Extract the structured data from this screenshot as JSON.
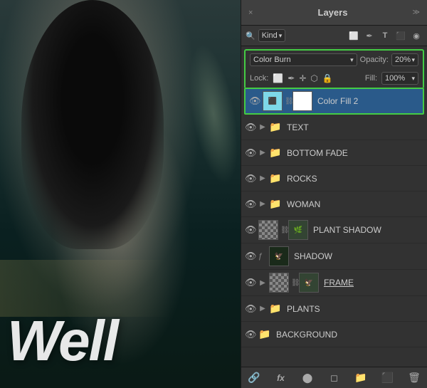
{
  "panel": {
    "title": "Layers",
    "close_label": "×",
    "collapse_label": "≫"
  },
  "filter_bar": {
    "filter_label": "Kind",
    "icons": [
      "pixel-icon",
      "brush-icon",
      "type-icon",
      "shape-icon",
      "adjustment-icon"
    ]
  },
  "blend_row": {
    "blend_mode": "Color Burn",
    "opacity_label": "Opacity:",
    "opacity_value": "20%",
    "chevron": "▾"
  },
  "lock_row": {
    "lock_label": "Lock:",
    "icons": [
      "lock-pixels-icon",
      "lock-position-icon",
      "lock-artboard-icon",
      "lock-all-icon"
    ],
    "fill_label": "Fill:",
    "fill_value": "100%",
    "fill_chevron": "▾"
  },
  "layers": [
    {
      "id": "color-fill-2",
      "name": "Color Fill 2",
      "visible": true,
      "selected": true,
      "has_arrow": false,
      "has_folder": false,
      "thumb1_type": "cyan",
      "thumb2_type": "white",
      "has_chain": true
    },
    {
      "id": "text",
      "name": "TEXT",
      "visible": true,
      "selected": false,
      "has_arrow": true,
      "has_folder": true,
      "thumb1_type": "folder",
      "thumb2_type": null,
      "has_chain": false
    },
    {
      "id": "bottom-fade",
      "name": "BOTTOM FADE",
      "visible": true,
      "selected": false,
      "has_arrow": true,
      "has_folder": true,
      "thumb1_type": "folder",
      "thumb2_type": null,
      "has_chain": false
    },
    {
      "id": "rocks",
      "name": "ROCKS",
      "visible": true,
      "selected": false,
      "has_arrow": true,
      "has_folder": true,
      "thumb1_type": "folder",
      "thumb2_type": null,
      "has_chain": false
    },
    {
      "id": "woman",
      "name": "WOMAN",
      "visible": true,
      "selected": false,
      "has_arrow": true,
      "has_folder": true,
      "thumb1_type": "folder",
      "thumb2_type": null,
      "has_chain": false
    },
    {
      "id": "plant-shadow",
      "name": "PLANT SHADOW",
      "visible": true,
      "selected": false,
      "has_arrow": false,
      "has_folder": false,
      "thumb1_type": "checker",
      "thumb2_type": "plant",
      "has_chain": true
    },
    {
      "id": "shadow",
      "name": "SHADOW",
      "visible": true,
      "selected": false,
      "has_arrow": false,
      "has_folder": false,
      "thumb1_type": "shadow",
      "thumb2_type": null,
      "has_chain": false,
      "has_special": true
    },
    {
      "id": "frame",
      "name": "FRAME",
      "visible": true,
      "selected": false,
      "has_arrow": true,
      "has_folder": false,
      "thumb1_type": "checker",
      "thumb2_type": "plant",
      "has_chain": true,
      "name_underline": true
    },
    {
      "id": "plants",
      "name": "PLANTS",
      "visible": true,
      "selected": false,
      "has_arrow": true,
      "has_folder": true,
      "thumb1_type": "folder",
      "thumb2_type": null,
      "has_chain": false
    },
    {
      "id": "background",
      "name": "BACKGROUND",
      "visible": true,
      "selected": false,
      "has_arrow": false,
      "has_folder": true,
      "thumb1_type": "folder",
      "thumb2_type": null,
      "has_chain": false
    }
  ],
  "bottom_bar": {
    "link_icon": "🔗",
    "fx_label": "fx",
    "adjustment_icon": "⬤",
    "brush_icon": "◻",
    "folder_icon": "📁",
    "delete_icon": "🗑"
  },
  "photo_text": "Well"
}
